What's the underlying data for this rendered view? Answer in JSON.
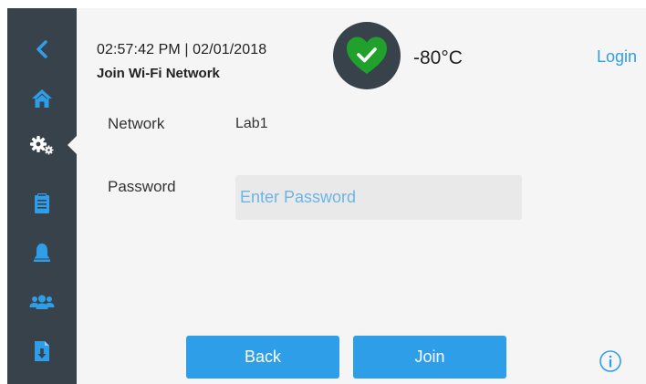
{
  "header": {
    "datetime": "02:57:42 PM | 02/01/2018",
    "title": "Join Wi-Fi Network",
    "temperature": "-80°C",
    "login_label": "Login",
    "status_icon": "heart-check-icon",
    "status_color": "#1fa12c"
  },
  "sidebar": {
    "items": [
      {
        "icon": "back-arrow-icon"
      },
      {
        "icon": "home-icon"
      },
      {
        "icon": "settings-icon",
        "active": true
      },
      {
        "icon": "clipboard-icon"
      },
      {
        "icon": "bell-icon"
      },
      {
        "icon": "users-icon"
      },
      {
        "icon": "document-download-icon"
      }
    ]
  },
  "form": {
    "network_label": "Network",
    "network_value": "Lab1",
    "password_label": "Password",
    "password_placeholder": "Enter Password",
    "password_value": ""
  },
  "actions": {
    "back_label": "Back",
    "join_label": "Join",
    "info_icon": "info-icon"
  },
  "colors": {
    "sidebar_bg": "#37424b",
    "accent": "#2f9ee8",
    "status_green": "#1fa12c",
    "panel_bg": "#f5f5f5"
  }
}
